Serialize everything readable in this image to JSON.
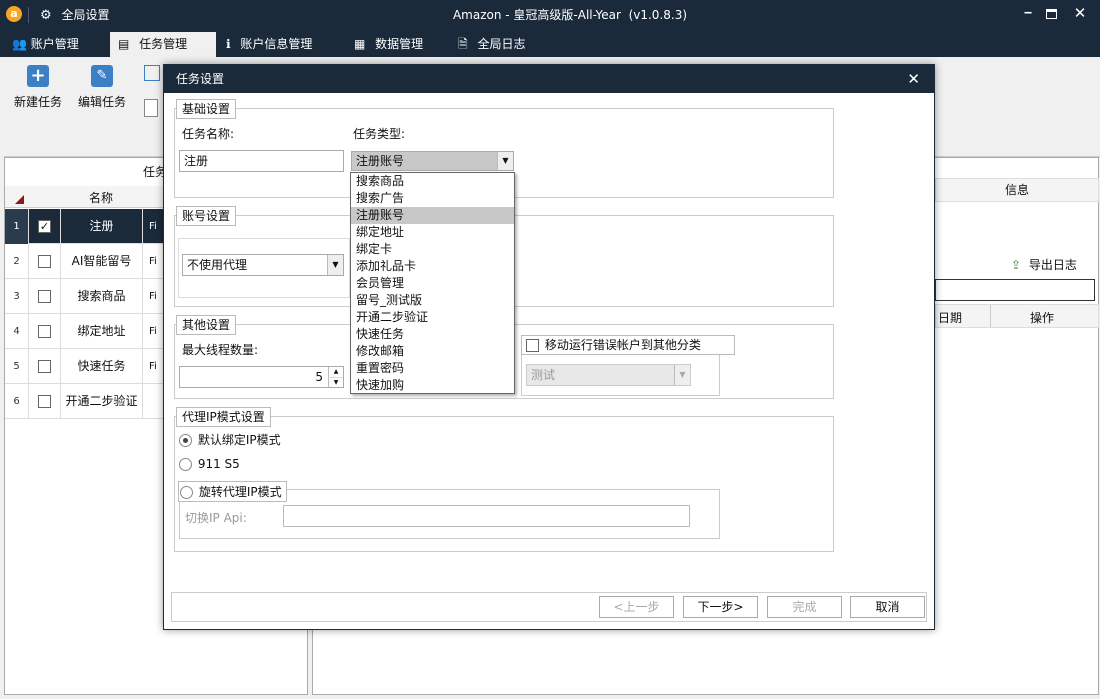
{
  "window": {
    "title": "Amazon - 皇冠高级版-All-Year  (v1.0.8.3)",
    "settings_label": "全局设置"
  },
  "tabs": [
    {
      "label": "账户管理",
      "icon": "users-icon"
    },
    {
      "label": "任务管理",
      "icon": "task-list-icon"
    },
    {
      "label": "账户信息管理",
      "icon": "info-icon"
    },
    {
      "label": "数据管理",
      "icon": "grid-icon"
    },
    {
      "label": "全局日志",
      "icon": "log-icon"
    }
  ],
  "toolbar": {
    "new_task": "新建任务",
    "edit_task": "编辑任务"
  },
  "left_panel": {
    "header_fragment": "任务",
    "col_name": "名称",
    "rows": [
      {
        "num": "1",
        "checked": "✓",
        "name": "注册",
        "extra": "Fi"
      },
      {
        "num": "2",
        "checked": "",
        "name": "AI智能留号",
        "extra": "Fi"
      },
      {
        "num": "3",
        "checked": "",
        "name": "搜索商品",
        "extra": "Fi"
      },
      {
        "num": "4",
        "checked": "",
        "name": "绑定地址",
        "extra": "Fi"
      },
      {
        "num": "5",
        "checked": "",
        "name": "快速任务",
        "extra": "Fi"
      },
      {
        "num": "6",
        "checked": "",
        "name": "开通二步验证",
        "extra": ""
      }
    ]
  },
  "right_panel": {
    "info_header": "信息",
    "export_log": "导出日志",
    "col_date": "日期",
    "col_action": "操作"
  },
  "dialog": {
    "title": "任务设置",
    "basic": {
      "legend": "基础设置",
      "name_label": "任务名称:",
      "name_value": "注册",
      "type_label": "任务类型:",
      "type_value": "注册账号"
    },
    "task_types": [
      "搜索商品",
      "搜索广告",
      "注册账号",
      "绑定地址",
      "绑定卡",
      "添加礼品卡",
      "会员管理",
      "留号_测试版",
      "开通二步验证",
      "快速任务",
      "修改邮箱",
      "重置密码",
      "快速加购"
    ],
    "selected_type_index": 2,
    "account": {
      "legend": "账号设置",
      "proxy_value": "不使用代理"
    },
    "other": {
      "legend": "其他设置",
      "threads_label": "最大线程数量:",
      "threads_value": "5",
      "move_label": "移动运行错误帐户到其他分类",
      "category_value": "测试"
    },
    "proxy_mode": {
      "legend": "代理IP模式设置",
      "opt_default": "默认绑定IP模式",
      "opt_911": "911 S5",
      "opt_rotate": "旋转代理IP模式",
      "switch_api_label": "切换IP Api:",
      "switch_api_value": ""
    },
    "buttons": {
      "prev": "<上一步",
      "next": "下一步>",
      "finish": "完成",
      "cancel": "取消"
    }
  },
  "colors": {
    "titlebar": "#1b2a3a",
    "selected_row": "#1b2a3a"
  }
}
